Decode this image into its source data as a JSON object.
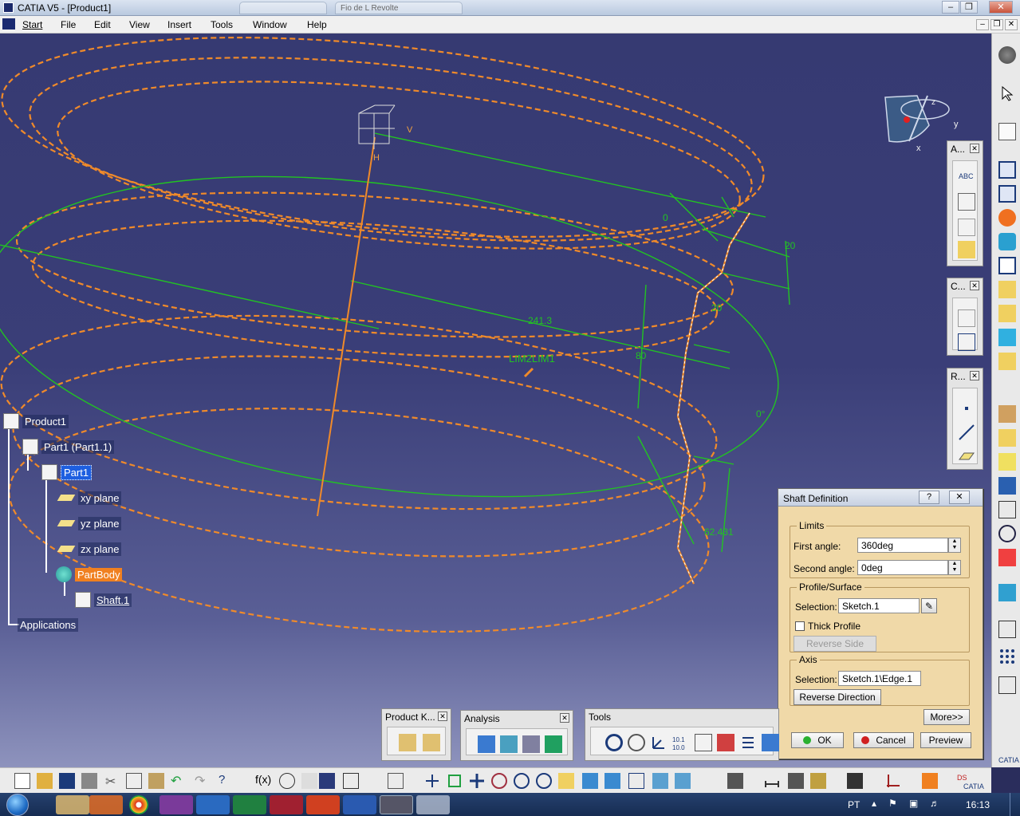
{
  "window": {
    "title": "CATIA V5 - [Product1]",
    "ghost_tabs": [
      "",
      "Fio de L Revolte"
    ]
  },
  "menu": {
    "items": [
      "Start",
      "File",
      "Edit",
      "View",
      "Insert",
      "Tools",
      "Window",
      "Help"
    ]
  },
  "viewport": {
    "compass": {
      "x": "x",
      "y": "y",
      "z": "z"
    },
    "axis_labels": {
      "v": "V",
      "h": "H"
    },
    "dimensions": [
      "0",
      "20",
      "20",
      "241.3",
      "80",
      "0°",
      "62.431"
    ],
    "sketch_label": "LIM2LIM1"
  },
  "tree": {
    "product": "Product1",
    "part_instance": "Part1 (Part1.1)",
    "part": "Part1",
    "xy": "xy plane",
    "yz": "yz plane",
    "zx": "zx plane",
    "body": "PartBody",
    "shaft": "Shaft.1",
    "applications": "Applications"
  },
  "toolbars": {
    "annotations": "A...",
    "constraints": "C...",
    "reference": "R...",
    "product_knowledge": "Product K...",
    "analysis": "Analysis",
    "tools": "Tools"
  },
  "dialog": {
    "title": "Shaft Definition",
    "help": "?",
    "limits_label": "Limits",
    "first_angle_label": "First angle:",
    "first_angle_value": "360deg",
    "second_angle_label": "Second angle:",
    "second_angle_value": "0deg",
    "profile_label": "Profile/Surface",
    "profile_selection_label": "Selection:",
    "profile_selection_value": "Sketch.1",
    "thick_profile_label": "Thick Profile",
    "reverse_side_label": "Reverse Side",
    "axis_label": "Axis",
    "axis_selection_label": "Selection:",
    "axis_selection_value": "Sketch.1\\Edge.1",
    "reverse_direction_label": "Reverse Direction",
    "more_label": "More>>",
    "ok_label": "OK",
    "cancel_label": "Cancel",
    "preview_label": "Preview"
  },
  "taskbar": {
    "language": "PT",
    "time": "16:13"
  },
  "colors": {
    "viewport_top": "#363a72",
    "viewport_bottom": "#8e93bd",
    "sketch_green": "#22c322",
    "preview_orange": "#f08a2a",
    "dialog_bg": "#f0d9a8",
    "selection_blue": "#1e5fe0"
  }
}
